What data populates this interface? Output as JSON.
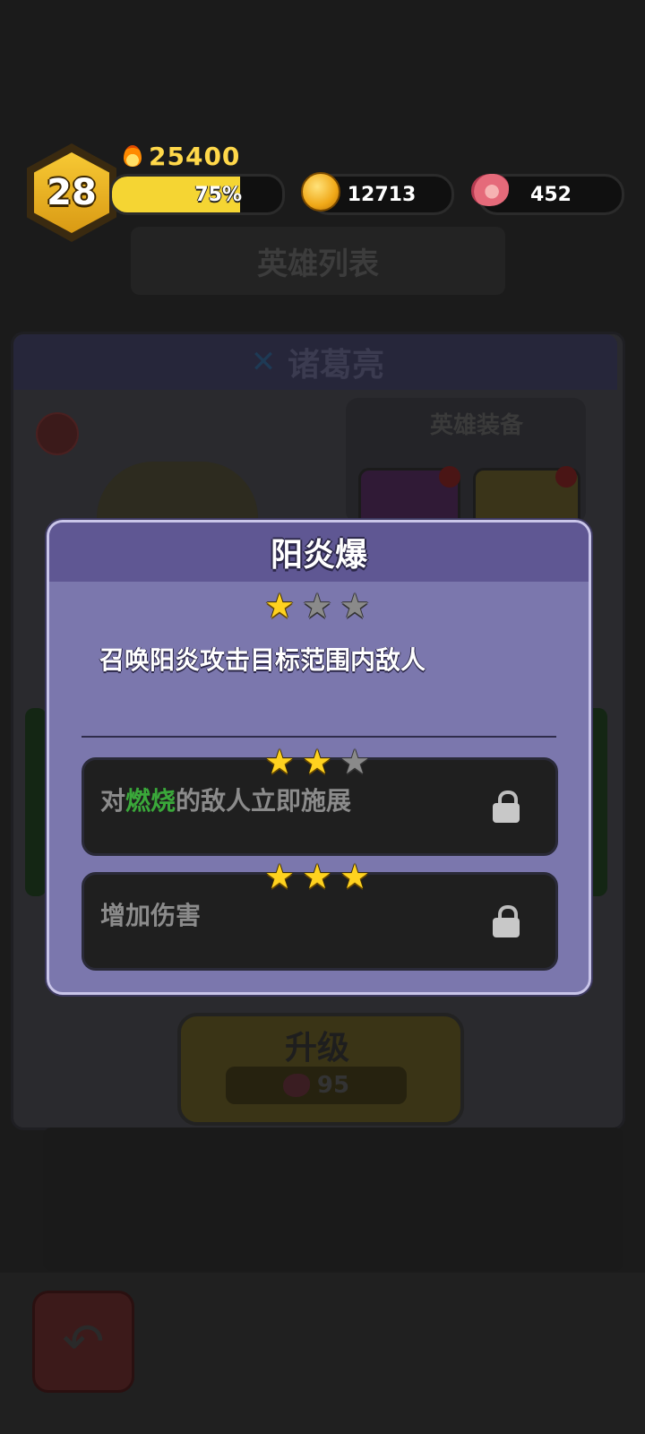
{
  "hud": {
    "level": "28",
    "power": "25400",
    "xp_percent_label": "75%",
    "xp_fraction": 0.75,
    "coins": "12713",
    "meat": "452"
  },
  "background": {
    "title": "英雄列表",
    "hero_name": "诸葛亮",
    "equip_label": "英雄装备",
    "upgrade_label": "升级",
    "upgrade_cost": "95"
  },
  "dialog": {
    "title": "阳炎爆",
    "current_stars": 1,
    "description": "召唤阳炎攻击目标范围内敌人",
    "perks": [
      {
        "stars": 2,
        "text_prefix": "对",
        "text_highlight": "燃烧",
        "text_suffix": "的敌人立即施展",
        "locked": true
      },
      {
        "stars": 3,
        "text_prefix": "增加伤害",
        "text_highlight": "",
        "text_suffix": "",
        "locked": true
      }
    ]
  },
  "colors": {
    "dialog_bg": "#7b77ad",
    "dialog_header": "#5f5793",
    "star_gold": "#ffd21f",
    "star_gray": "#8a8a8a",
    "highlight_green": "#3aa83a"
  },
  "icons": {
    "power": "flame-icon",
    "coins": "gold-coin-icon",
    "meat": "meat-icon",
    "lock": "lock-icon",
    "back": "back-arrow-icon",
    "search": "search-icon"
  }
}
